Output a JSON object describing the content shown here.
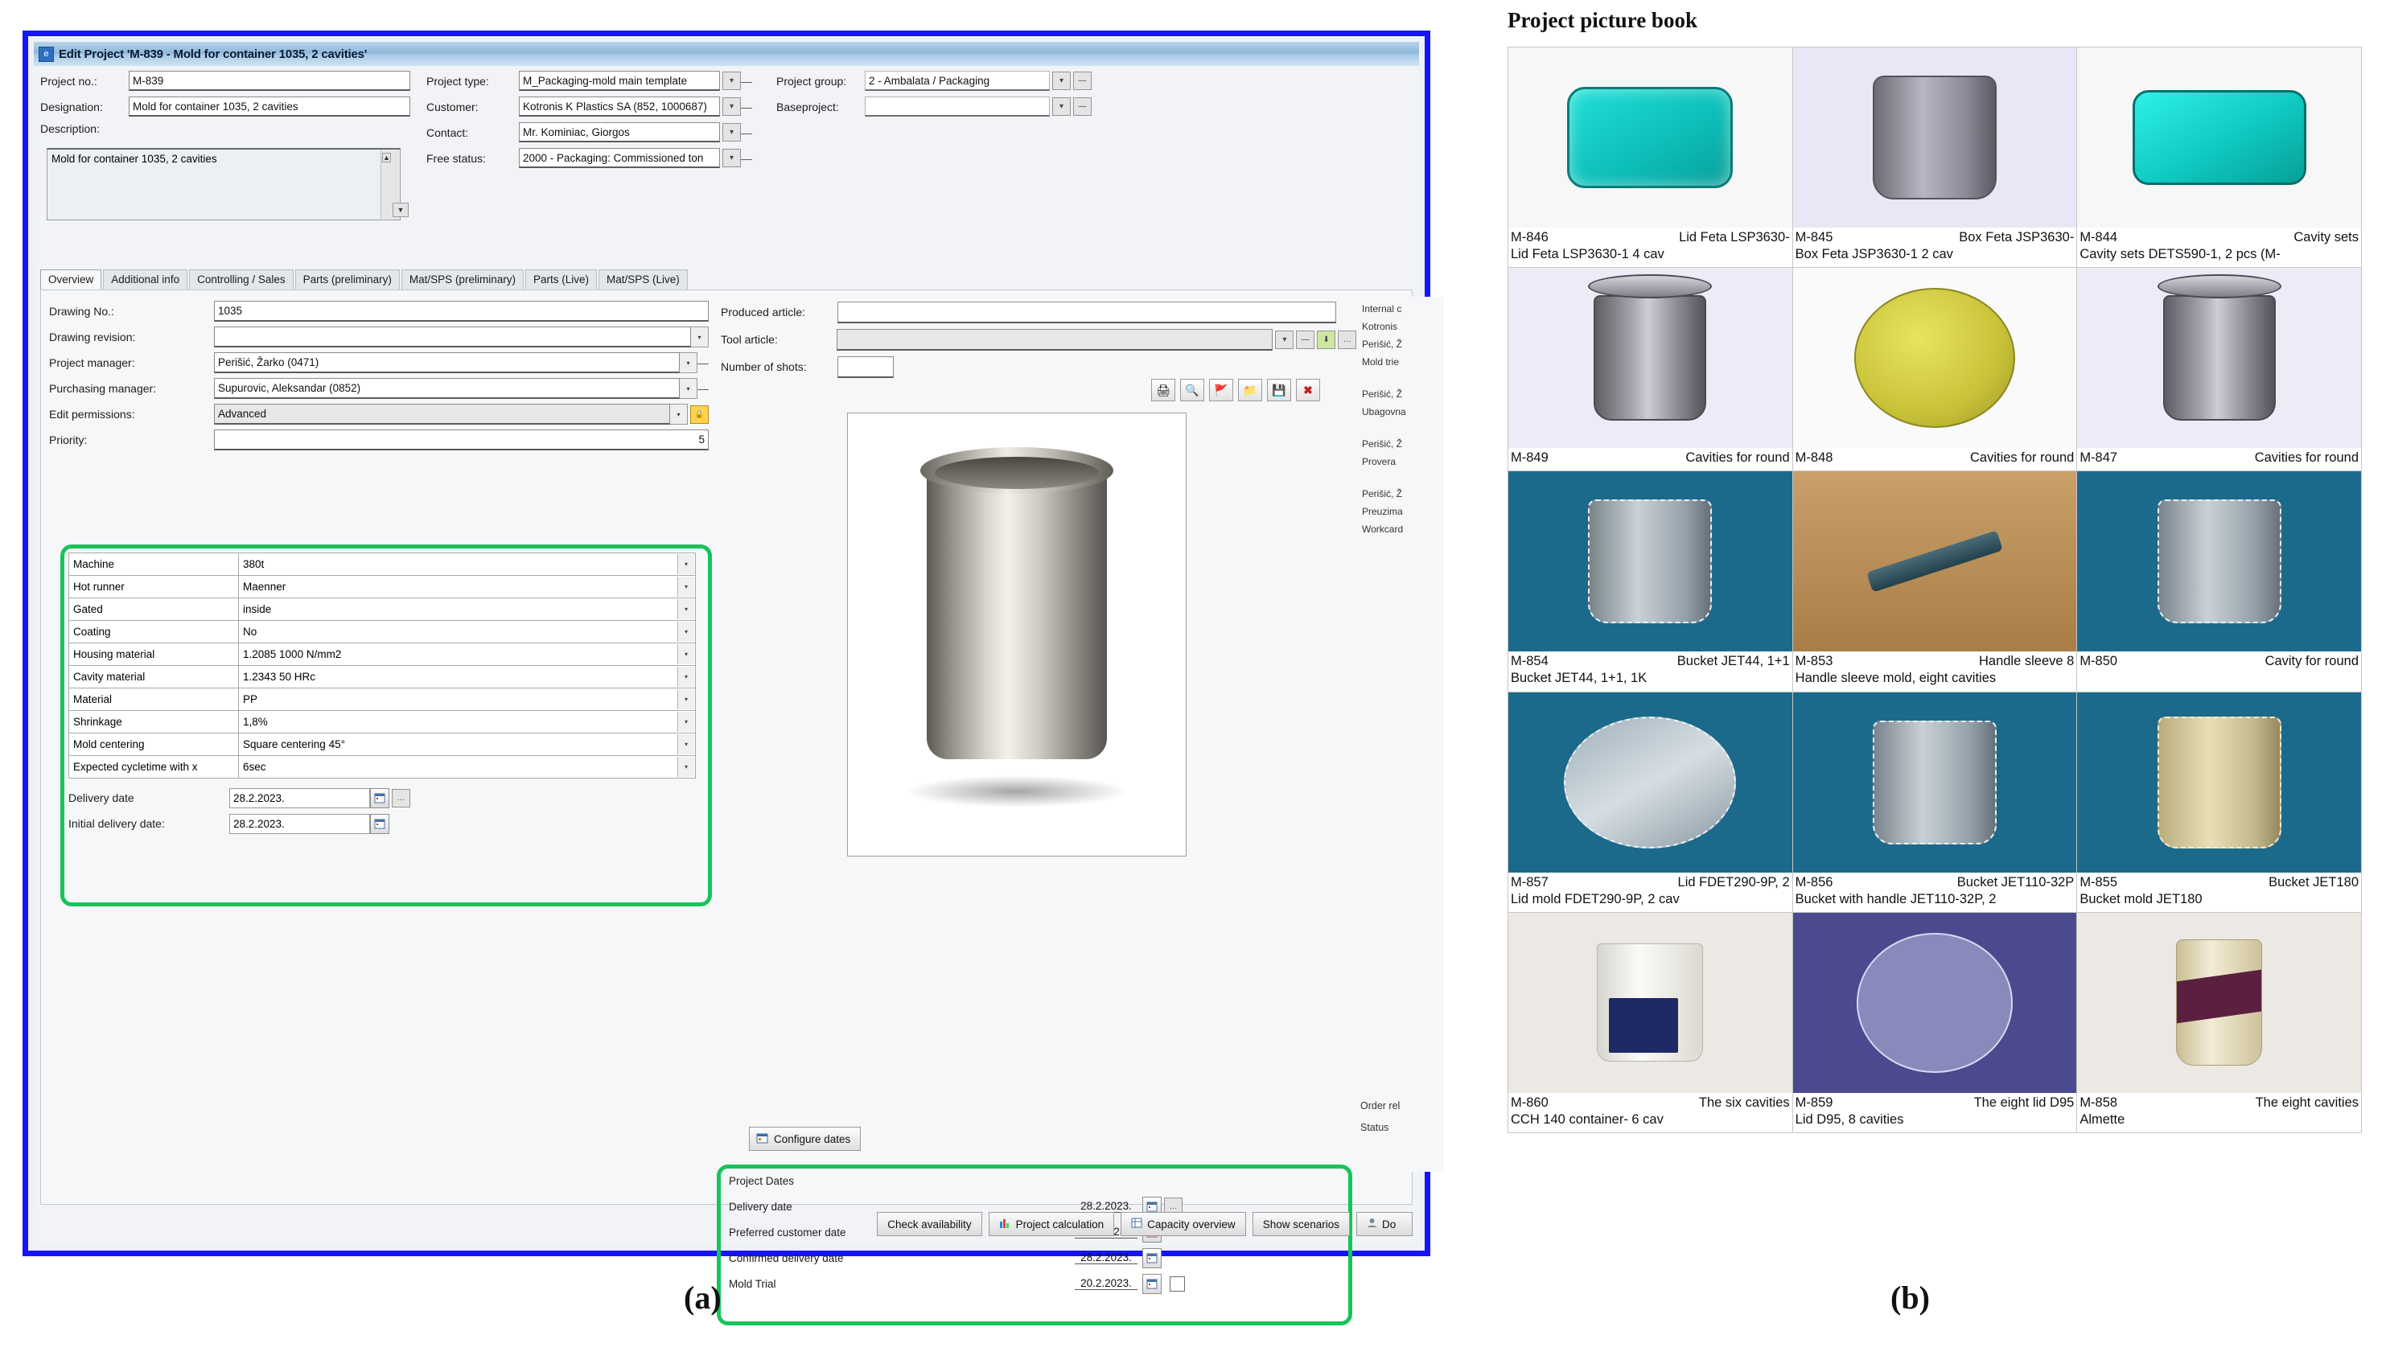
{
  "figure_a": {
    "caption": "(a)",
    "window": {
      "title": "Edit Project 'M-839 - Mold for container 1035, 2 cavities'",
      "icon": "e"
    },
    "header": {
      "project_no_label": "Project no.:",
      "project_no_value": "M-839",
      "designation_label": "Designation:",
      "designation_value": "Mold for container 1035, 2 cavities",
      "description_label": "Description:",
      "description_value": "Mold for container 1035, 2 cavities",
      "project_type_label": "Project type:",
      "project_type_value": "M_Packaging-mold main template",
      "customer_label": "Customer:",
      "customer_value": "Kotronis K Plastics SA (852, 1000687)",
      "contact_label": "Contact:",
      "contact_value": "Mr. Kominiac, Giorgos",
      "free_status_label": "Free status:",
      "free_status_value": "2000 - Packaging: Commissioned ton",
      "project_group_label": "Project group:",
      "project_group_value": "2 - Ambalata / Packaging",
      "baseproject_label": "Baseproject:",
      "baseproject_value": ""
    },
    "tabs": [
      {
        "label": "Overview",
        "active": true
      },
      {
        "label": "Additional info",
        "active": false
      },
      {
        "label": "Controlling / Sales",
        "active": false
      },
      {
        "label": "Parts (preliminary)",
        "active": false
      },
      {
        "label": "Mat/SPS (preliminary)",
        "active": false
      },
      {
        "label": "Parts (Live)",
        "active": false
      },
      {
        "label": "Mat/SPS (Live)",
        "active": false
      }
    ],
    "left_fields": [
      {
        "label": "Drawing No.:",
        "value": "1035"
      },
      {
        "label": "Drawing revision:",
        "value": ""
      },
      {
        "label": "Project manager:",
        "value": "Perišić, Žarko (0471)"
      },
      {
        "label": "Purchasing manager:",
        "value": "Supurovic, Aleksandar (0852)"
      },
      {
        "label": "Edit permissions:",
        "value": "Advanced"
      },
      {
        "label": "Priority:",
        "value": "5"
      }
    ],
    "highlighted_fields": [
      {
        "label": "Machine",
        "value": "380t"
      },
      {
        "label": "Hot runner",
        "value": "Maenner"
      },
      {
        "label": "Gated",
        "value": "inside"
      },
      {
        "label": "Coating",
        "value": "No"
      },
      {
        "label": "Housing material",
        "value": "1.2085 1000 N/mm2"
      },
      {
        "label": "Cavity material",
        "value": "1.2343 50 HRc"
      },
      {
        "label": "Material",
        "value": "PP"
      },
      {
        "label": "Shrinkage",
        "value": "1,8%"
      },
      {
        "label": "Mold centering",
        "value": "Square centering 45°"
      },
      {
        "label": "Expected cycletime with x",
        "value": "6sec"
      }
    ],
    "delivery_fields": [
      {
        "label": "Delivery date",
        "value": "28.2.2023."
      },
      {
        "label": "Initial delivery date:",
        "value": "28.2.2023."
      }
    ],
    "right_fields": [
      {
        "label": "Produced article:",
        "value": ""
      },
      {
        "label": "Tool article:",
        "value": ""
      },
      {
        "label": "Number of shots:",
        "value": ""
      }
    ],
    "viewer_toolbar": [
      "print-icon",
      "zoom-icon",
      "flag-icon",
      "folder-icon",
      "save-icon",
      "delete-icon"
    ],
    "side_panel": {
      "internal_label": "Internal c",
      "entries": [
        "Kotronis",
        "Perišić, Ž",
        "Mold trie",
        "Perišić, Ž",
        "Ubagovna",
        "Perišić, Ž",
        "Provera",
        "Perišić, Ž",
        "Preuzima",
        "Workcard"
      ],
      "order_related": "Order rel",
      "status": "Status"
    },
    "project_dates": {
      "title": "Project Dates",
      "rows": [
        {
          "label": "Delivery date",
          "value": "28.2.2023.",
          "checkbox": false
        },
        {
          "label": "Preferred customer date",
          "value": "6.2.2023.",
          "checkbox": false
        },
        {
          "label": "Confirmed delivery date",
          "value": "28.2.2023.",
          "checkbox": false
        },
        {
          "label": "Mold Trial",
          "value": "20.2.2023.",
          "checkbox": true
        }
      ]
    },
    "configure_dates_label": "Configure dates",
    "footer_buttons": [
      {
        "label": "Check availability",
        "icon": ""
      },
      {
        "label": "Project calculation",
        "icon": "chart-icon"
      },
      {
        "label": "Capacity overview",
        "icon": "capacity-icon"
      },
      {
        "label": "Show scenarios",
        "icon": ""
      },
      {
        "label": "Do",
        "icon": "user-icon"
      }
    ],
    "highlight_color": "#16c45a",
    "window_border_color": "#1414ff"
  },
  "figure_b": {
    "caption": "(b)",
    "title": "Project picture book",
    "items": [
      {
        "id": "M-846",
        "right": "Lid Feta LSP3630-",
        "desc": "Lid Feta LSP3630-1 4 cav",
        "thumb": "lid-teal"
      },
      {
        "id": "M-845",
        "right": "Box Feta JSP3630-",
        "desc": "Box Feta JSP3630-1  2 cav",
        "thumb": "box-grey"
      },
      {
        "id": "M-844",
        "right": "Cavity sets",
        "desc": "Cavity sets DETS590-1, 2 pcs (M-",
        "thumb": "lid-teal2"
      },
      {
        "id": "M-849",
        "right": "Cavities for round",
        "desc": "",
        "thumb": "pail-grey"
      },
      {
        "id": "M-848",
        "right": "Cavities for round",
        "desc": "",
        "thumb": "disc-yellow"
      },
      {
        "id": "M-847",
        "right": "Cavities for round",
        "desc": "",
        "thumb": "pail-grey"
      },
      {
        "id": "M-854",
        "right": "Bucket JET44, 1+1",
        "desc": "Bucket JET44, 1+1, 1K",
        "thumb": "cad-pail-blue"
      },
      {
        "id": "M-853",
        "right": "Handle sleeve 8",
        "desc": "Handle sleeve mold, eight cavities",
        "thumb": "sleeve-wood"
      },
      {
        "id": "M-850",
        "right": "Cavity for round",
        "desc": "",
        "thumb": "cad-pail-blue2"
      },
      {
        "id": "M-857",
        "right": "Lid FDET290-9P, 2",
        "desc": "Lid mold FDET290-9P, 2 cav",
        "thumb": "cad-lid-blue"
      },
      {
        "id": "M-856",
        "right": "Bucket JET110-32P",
        "desc": "Bucket with handle JET110-32P, 2",
        "thumb": "cad-pail-blue3"
      },
      {
        "id": "M-855",
        "right": "Bucket JET180",
        "desc": "Bucket mold JET180",
        "thumb": "cad-pail-tan"
      },
      {
        "id": "M-860",
        "right": "The six cavities",
        "desc": "CCH 140 container- 6 cav",
        "thumb": "photo-tub"
      },
      {
        "id": "M-859",
        "right": "The eight lid D95",
        "desc": "Lid D95, 8 cavities",
        "thumb": "violet-ring"
      },
      {
        "id": "M-858",
        "right": "The eight cavities",
        "desc": "Almette",
        "thumb": "photo-almette"
      }
    ]
  }
}
